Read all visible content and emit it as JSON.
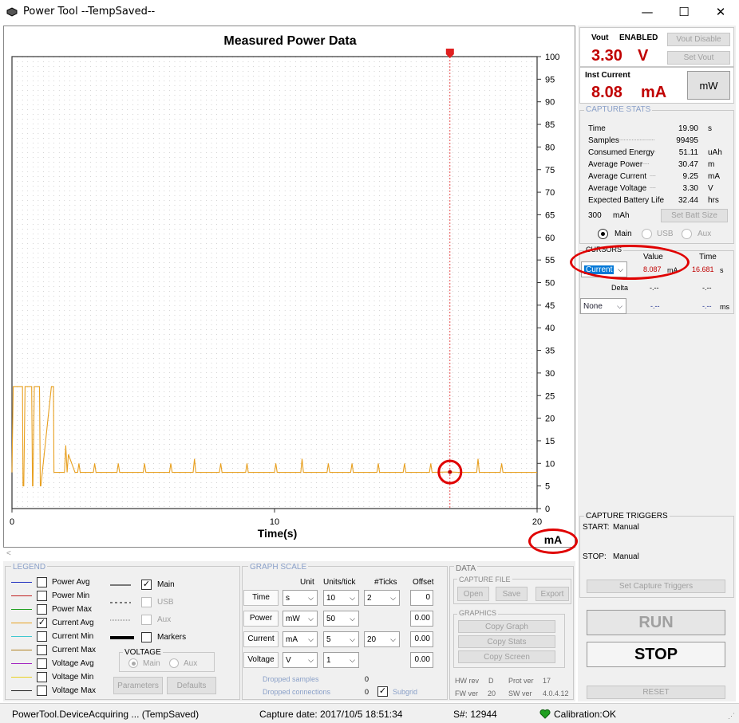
{
  "app": {
    "title": "Power Tool --TempSaved--"
  },
  "graph": {
    "title": "Measured Power Data",
    "xlabel": "Time(s)",
    "unit_badge": "mA",
    "x_ticks": [
      "0",
      "10",
      "20"
    ],
    "y_ticks": [
      "100",
      "95",
      "90",
      "85",
      "80",
      "75",
      "70",
      "65",
      "60",
      "55",
      "50",
      "45",
      "40",
      "35",
      "30",
      "25",
      "20",
      "15",
      "10",
      "5",
      "0"
    ],
    "cursor_time": 16.681,
    "cursor_value": 8.087
  },
  "chart_data": {
    "type": "line",
    "title": "Measured Power Data",
    "xlabel": "Time(s)",
    "ylabel": "mA",
    "xlim": [
      0,
      20
    ],
    "ylim": [
      0,
      100
    ],
    "grid": true,
    "series": [
      {
        "name": "Current Avg",
        "color": "#e8a020",
        "x": [
          0,
          0.05,
          0.1,
          0.3,
          0.4,
          0.42,
          0.45,
          0.5,
          0.75,
          0.78,
          0.8,
          0.85,
          1.05,
          1.08,
          1.1,
          1.5,
          1.55,
          1.58,
          1.6,
          2.0,
          2.05,
          2.1,
          2.15,
          2.4,
          2.5,
          2.55,
          2.6,
          3.1,
          3.15,
          3.2,
          4.0,
          4.05,
          4.1,
          5.0,
          5.05,
          5.1,
          6.0,
          6.05,
          6.1,
          6.9,
          6.95,
          7.0,
          7.9,
          7.95,
          8.0,
          8.9,
          8.95,
          9.0,
          10.0,
          10.05,
          10.1,
          11.0,
          11.05,
          11.1,
          12.0,
          12.05,
          12.1,
          12.9,
          12.95,
          13.0,
          13.9,
          13.95,
          14.0,
          14.9,
          14.95,
          15.0,
          15.9,
          15.95,
          16.0,
          16.681,
          17.0,
          17.7,
          17.75,
          17.8,
          18.6,
          18.65,
          18.7,
          20.0
        ],
        "y": [
          8,
          27,
          27,
          27,
          27,
          5,
          5,
          27,
          27,
          5,
          5,
          27,
          27,
          5,
          5,
          27,
          27,
          27,
          8,
          8,
          14,
          8,
          12,
          8,
          8,
          10,
          8,
          8,
          10,
          8,
          8,
          10,
          8,
          8,
          10,
          8,
          8,
          10,
          8,
          8,
          11,
          8,
          8,
          10,
          8,
          8,
          10,
          8,
          8,
          10,
          8,
          8,
          11,
          8,
          8,
          10,
          8,
          8,
          10,
          8,
          8,
          10,
          8,
          8,
          10,
          8,
          8,
          10,
          8,
          8.087,
          8,
          8,
          11,
          8,
          8,
          10,
          8,
          8
        ]
      }
    ]
  },
  "side": {
    "vout_label": "Vout",
    "vout_state": "ENABLED",
    "vout_value": "3.30",
    "vout_unit": "V",
    "vout_disable_btn": "Vout Disable",
    "set_vout_btn": "Set Vout",
    "inst_label": "Inst Current",
    "inst_value": "8.08",
    "inst_unit": "mA",
    "mw_btn": "mW",
    "capture_stats_label": "CAPTURE STATS",
    "stats": [
      {
        "label": "Time",
        "dots": "",
        "value": "19.90",
        "unit": "s"
      },
      {
        "label": "Samples",
        "dots": "........................",
        "value": "99495",
        "unit": ""
      },
      {
        "label": "Consumed Energy",
        "dots": "....",
        "value": "51.11",
        "unit": "uAh"
      },
      {
        "label": "Average Power",
        "dots": ".....",
        "value": "30.47",
        "unit": "m"
      },
      {
        "label": "Average Current",
        "dots": "....",
        "value": "9.25",
        "unit": "mA"
      },
      {
        "label": "Average Voltage",
        "dots": "....",
        "value": "3.30",
        "unit": "V"
      },
      {
        "label": "Expected Battery Life",
        "dots": "",
        "value": "32.44",
        "unit": "hrs"
      }
    ],
    "batt_value": "300",
    "batt_unit": "mAh",
    "set_batt_btn": "Set Batt Size",
    "radio_main": "Main",
    "radio_usb": "USB",
    "radio_aux": "Aux",
    "cursors_label": "CURSORS",
    "col_value": "Value",
    "col_time": "Time",
    "cursor_sel": "Current",
    "cursor_value": "8.087",
    "cursor_value_unit": "mA",
    "cursor_time": "16.681",
    "cursor_time_unit": "s",
    "delta_label": "Delta",
    "delta_value": "-.--",
    "delta_time": "-.--",
    "none_sel": "None",
    "none_value": "-.--",
    "none_time": "-.--",
    "none_unit": "ms",
    "triggers_label": "CAPTURE TRIGGERS",
    "start_label": "START:",
    "start_value": "Manual",
    "stop_label": "STOP:",
    "stop_value": "Manual",
    "set_triggers_btn": "Set Capture Triggers",
    "run_btn": "RUN",
    "stop_btn": "STOP",
    "reset_btn": "RESET"
  },
  "legend": {
    "label": "LEGEND",
    "items": [
      {
        "name": "Power Avg",
        "color": "#2030c0",
        "checked": false,
        "style": "solid"
      },
      {
        "name": "Power Min",
        "color": "#c02020",
        "checked": false,
        "style": "solid"
      },
      {
        "name": "Power Max",
        "color": "#20a020",
        "checked": false,
        "style": "solid"
      },
      {
        "name": "Current Avg",
        "color": "#e8a020",
        "checked": true,
        "style": "solid"
      },
      {
        "name": "Current Min",
        "color": "#40c8d0",
        "checked": false,
        "style": "solid"
      },
      {
        "name": "Current Max",
        "color": "#b08020",
        "checked": false,
        "style": "solid"
      },
      {
        "name": "Voltage Avg",
        "color": "#a020c0",
        "checked": false,
        "style": "solid"
      },
      {
        "name": "Voltage Min",
        "color": "#e8d020",
        "checked": false,
        "style": "solid"
      },
      {
        "name": "Voltage Max",
        "color": "#202020",
        "checked": false,
        "style": "solid"
      }
    ],
    "main": "Main",
    "usb": "USB",
    "aux": "Aux",
    "markers": "Markers",
    "voltage_label": "VOLTAGE",
    "v_main": "Main",
    "v_aux": "Aux",
    "params_btn": "Parameters",
    "defaults_btn": "Defaults"
  },
  "scale": {
    "label": "GRAPH SCALE",
    "h_unit": "Unit",
    "h_units_tick": "Units/tick",
    "h_ticks": "#Ticks",
    "h_offset": "Offset",
    "rows": [
      {
        "name": "Time",
        "unit": "s",
        "upt": "10",
        "ticks": "2",
        "offset": "0"
      },
      {
        "name": "Power",
        "unit": "mW",
        "upt": "50",
        "ticks": "",
        "offset": "0.00"
      },
      {
        "name": "Current",
        "unit": "mA",
        "upt": "5",
        "ticks": "20",
        "offset": "0.00"
      },
      {
        "name": "Voltage",
        "unit": "V",
        "upt": "1",
        "ticks": "",
        "offset": "0.00"
      }
    ],
    "dropped_samples": "Dropped samples",
    "dropped_samples_v": "0",
    "dropped_conn": "Dropped connections",
    "dropped_conn_v": "0",
    "subgrid": "Subgrid"
  },
  "data_panel": {
    "label": "DATA",
    "capture_file": "CAPTURE FILE",
    "open": "Open",
    "save": "Save",
    "export": "Export",
    "graphics": "GRAPHICS",
    "copy_graph": "Copy Graph",
    "copy_stats": "Copy Stats",
    "copy_screen": "Copy Screen",
    "hw_rev": "HW rev",
    "hw_rev_v": "D",
    "prot_ver": "Prot ver",
    "prot_ver_v": "17",
    "fw_ver": "FW ver",
    "fw_ver_v": "20",
    "sw_ver": "SW ver",
    "sw_ver_v": "4.0.4.12"
  },
  "status": {
    "state": "PowerTool.DeviceAcquiring ... (TempSaved)",
    "capture_date": "Capture date: 2017/10/5 18:51:34",
    "serial": "S#: 12944",
    "calibration": "Calibration:OK"
  }
}
